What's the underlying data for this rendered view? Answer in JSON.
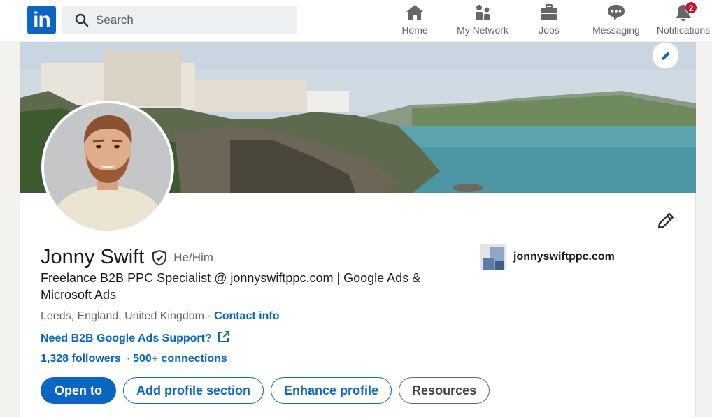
{
  "nav": {
    "logo_text": "in",
    "search": {
      "placeholder": "Search"
    },
    "items": [
      {
        "label": "Home",
        "icon": "home-icon"
      },
      {
        "label": "My Network",
        "icon": "network-icon"
      },
      {
        "label": "Jobs",
        "icon": "briefcase-icon"
      },
      {
        "label": "Messaging",
        "icon": "messaging-icon"
      },
      {
        "label": "Notifications",
        "icon": "bell-icon",
        "badge": "2"
      }
    ]
  },
  "profile": {
    "name": "Jonny Swift",
    "pronouns": "He/Him",
    "headline": "Freelance B2B PPC Specialist @ jonnyswiftppc.com | Google Ads & Microsoft Ads",
    "location": "Leeds, England, United Kingdom",
    "location_separator": " · ",
    "contact_label": "Contact info",
    "featured_link": "Need B2B Google Ads Support?",
    "followers": "1,328 followers",
    "count_separator": "·",
    "connections": "500+ connections",
    "website": "jonnyswiftppc.com",
    "buttons": {
      "open_to": "Open to",
      "add_section": "Add profile section",
      "enhance": "Enhance profile",
      "resources": "Resources"
    }
  },
  "colors": {
    "brand": "#0a66c2",
    "badge": "#cb112d",
    "page_bg": "#f4f2ee"
  }
}
